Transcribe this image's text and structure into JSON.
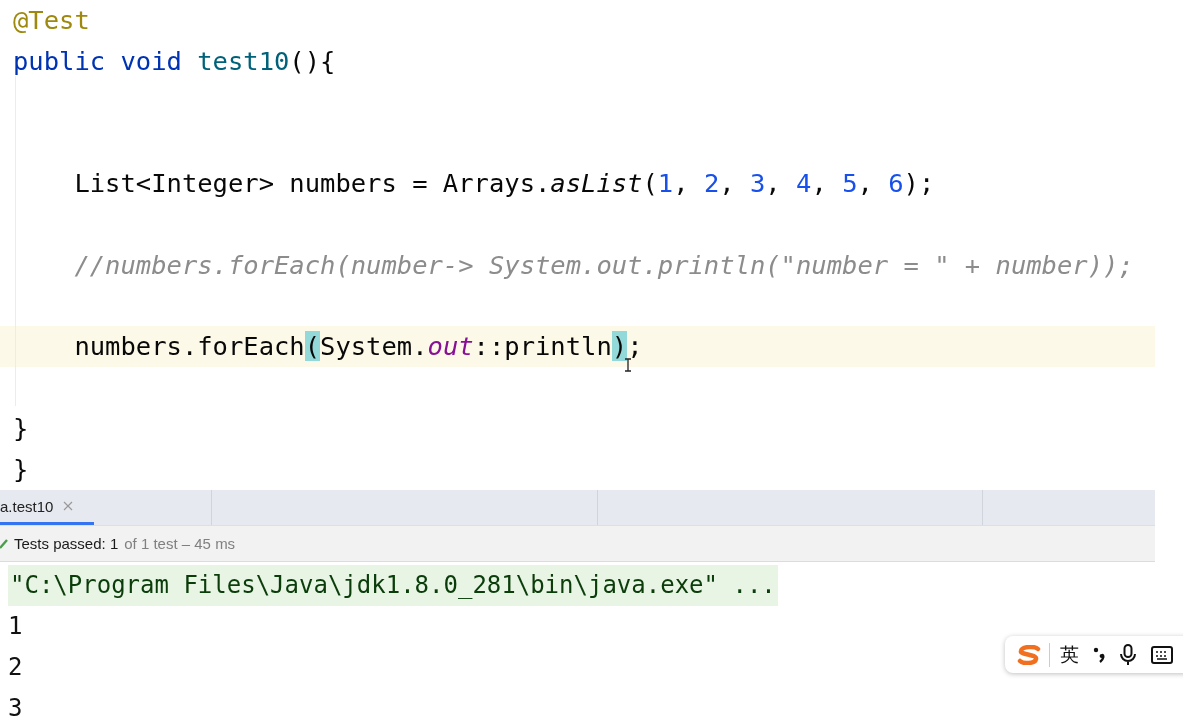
{
  "code": {
    "lines": [
      {
        "kind": "code",
        "current": false,
        "tokens": [
          {
            "text": "@Test",
            "kind": "annotation"
          }
        ]
      },
      {
        "kind": "code",
        "current": false,
        "tokens": [
          {
            "text": "public void ",
            "kind": "keyword"
          },
          {
            "text": "test10",
            "kind": "method"
          },
          {
            "text": "(){",
            "kind": "plain"
          }
        ]
      },
      {
        "kind": "blank",
        "current": false
      },
      {
        "kind": "blank",
        "current": false
      },
      {
        "kind": "code",
        "current": false,
        "tokens": [
          {
            "text": "    List<Integer> numbers = Arrays.",
            "kind": "plain"
          },
          {
            "text": "asList",
            "kind": "static"
          },
          {
            "text": "(",
            "kind": "plain"
          },
          {
            "text": "1",
            "kind": "number"
          },
          {
            "text": ", ",
            "kind": "plain"
          },
          {
            "text": "2",
            "kind": "number"
          },
          {
            "text": ", ",
            "kind": "plain"
          },
          {
            "text": "3",
            "kind": "number"
          },
          {
            "text": ", ",
            "kind": "plain"
          },
          {
            "text": "4",
            "kind": "number"
          },
          {
            "text": ", ",
            "kind": "plain"
          },
          {
            "text": "5",
            "kind": "number"
          },
          {
            "text": ", ",
            "kind": "plain"
          },
          {
            "text": "6",
            "kind": "number"
          },
          {
            "text": ");",
            "kind": "plain"
          }
        ]
      },
      {
        "kind": "blank",
        "current": false
      },
      {
        "kind": "code",
        "current": false,
        "tokens": [
          {
            "text": "    //numbers.forEach(number-> System.out.println(\"number = \" + number));",
            "kind": "comment"
          }
        ]
      },
      {
        "kind": "blank",
        "current": false
      },
      {
        "kind": "code",
        "current": true,
        "tokens": [
          {
            "text": "    numbers.forEach",
            "kind": "plain"
          },
          {
            "text": "(",
            "kind": "brace-match"
          },
          {
            "text": "System.",
            "kind": "plain"
          },
          {
            "text": "out",
            "kind": "field"
          },
          {
            "text": "::println",
            "kind": "plain"
          },
          {
            "text": ")",
            "kind": "brace-match"
          },
          {
            "text": ";",
            "kind": "plain"
          }
        ]
      },
      {
        "kind": "blank",
        "current": false
      },
      {
        "kind": "code",
        "current": false,
        "tokens": [
          {
            "text": "}",
            "kind": "plain"
          }
        ]
      },
      {
        "kind": "code",
        "current": false,
        "tokens": [
          {
            "text": "}",
            "kind": "plain"
          }
        ]
      }
    ]
  },
  "run_panel": {
    "tabs": [
      {
        "label": "a.test10",
        "selected": true
      }
    ],
    "status": {
      "summary": "Tests passed: 1",
      "detail": "of 1 test – 45 ms"
    },
    "console": [
      {
        "kind": "command",
        "text": "\"C:\\Program Files\\Java\\jdk1.8.0_281\\bin\\java.exe\" ..."
      },
      {
        "kind": "output",
        "text": "1"
      },
      {
        "kind": "output",
        "text": "2"
      },
      {
        "kind": "output",
        "text": "3"
      }
    ]
  },
  "ime_bar": {
    "mode": "英"
  }
}
